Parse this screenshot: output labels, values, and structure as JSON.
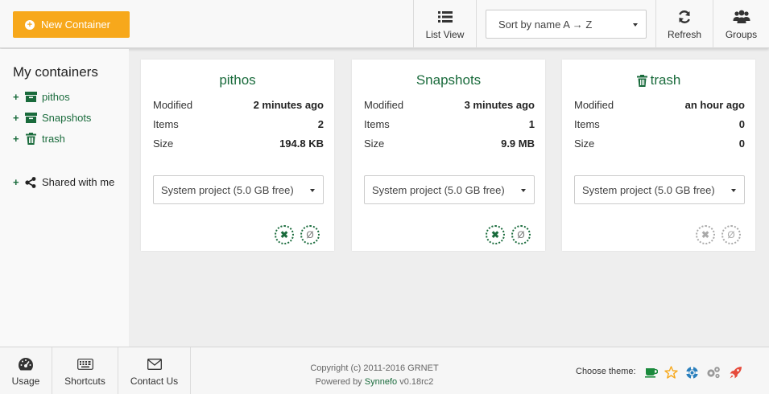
{
  "toolbar": {
    "new_container_label": "New Container",
    "list_view_label": "List View",
    "sort_value": "Sort by name A → Z",
    "refresh_label": "Refresh",
    "groups_label": "Groups"
  },
  "sidebar": {
    "title": "My containers",
    "items": [
      {
        "label": "pithos",
        "icon": "archive-icon"
      },
      {
        "label": "Snapshots",
        "icon": "archive-icon"
      },
      {
        "label": "trash",
        "icon": "trash-icon"
      }
    ],
    "shared_label": "Shared with me"
  },
  "labels": {
    "modified": "Modified",
    "items": "Items",
    "size": "Size"
  },
  "containers": [
    {
      "name": "pithos",
      "modified": "2 minutes ago",
      "items": "2",
      "size": "194.8 KB",
      "project": "System project (5.0 GB free)"
    },
    {
      "name": "Snapshots",
      "modified": "3 minutes ago",
      "items": "1",
      "size": "9.9 MB",
      "project": "System project (5.0 GB free)"
    },
    {
      "name": "trash",
      "modified": "an hour ago",
      "items": "0",
      "size": "0",
      "project": "System project (5.0 GB free)"
    }
  ],
  "actions": {
    "empty_glyph": "✖",
    "reset_glyph": "Ø"
  },
  "footer": {
    "usage_label": "Usage",
    "shortcuts_label": "Shortcuts",
    "contact_label": "Contact Us",
    "copyright": "Copyright (c) 2011-2016 GRNET",
    "powered_by_prefix": "Powered by",
    "powered_by_link": "Synnefo",
    "version": "v0.18rc2",
    "theme_label": "Choose theme:"
  },
  "colors": {
    "accent": "#f7a81b",
    "brand_green": "#1a6b3c"
  }
}
